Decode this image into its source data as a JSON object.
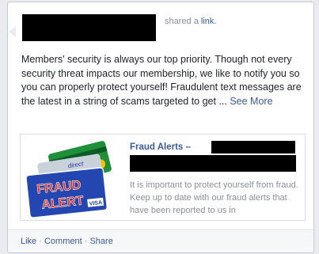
{
  "post": {
    "shared_prefix": "shared a",
    "shared_link_label": "link.",
    "body_text": "Members' security is always our top priority. Though not every security threat impacts our membership, we like to notify you so you can properly protect yourself! Fraudulent text messages are the latest in a string of scams targeted to get ...",
    "see_more_label": "See More"
  },
  "attachment": {
    "title": "Fraud Alerts –",
    "description": "It is important to protect yourself from fraud. Keep up to date with our fraud alerts that have been reported to us in",
    "thumbnail_text_line1": "FRAUD",
    "thumbnail_text_line2": "ALERT",
    "thumbnail_card_brand": "VISA",
    "thumbnail_card_text": "direct"
  },
  "actions": {
    "like": "Like",
    "comment": "Comment",
    "share": "Share",
    "separator": "·"
  },
  "colors": {
    "link": "#3b5998",
    "muted": "#8a8f99",
    "text": "#1d2129",
    "thumbnail_red": "#d4261c",
    "thumbnail_blue": "#1f3f9c"
  }
}
